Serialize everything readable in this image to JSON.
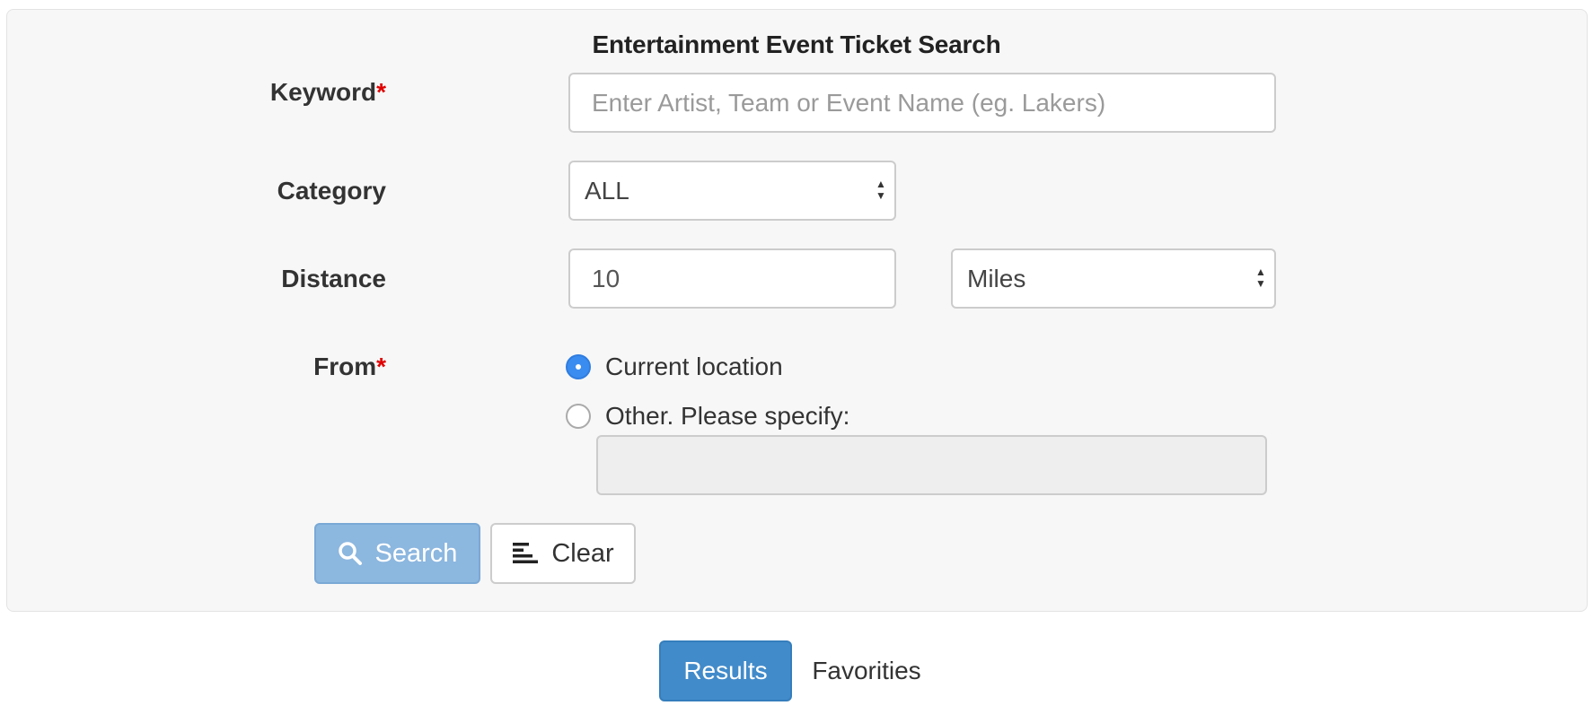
{
  "form": {
    "title": "Entertainment Event Ticket Search",
    "keyword": {
      "label": "Keyword",
      "required_mark": "*",
      "placeholder": "Enter Artist, Team or Event Name (eg. Lakers)"
    },
    "category": {
      "label": "Category",
      "selected": "ALL"
    },
    "distance": {
      "label": "Distance",
      "value": "10",
      "unit_selected": "Miles"
    },
    "from": {
      "label": "From",
      "required_mark": "*",
      "options": [
        {
          "label": "Current location",
          "checked": true
        },
        {
          "label": "Other. Please specify:",
          "checked": false
        }
      ],
      "other_value": ""
    },
    "buttons": {
      "search_label": "Search",
      "search_icon": "search-icon",
      "clear_label": "Clear",
      "clear_icon": "align-left-icon"
    }
  },
  "tabs": {
    "results_label": "Results",
    "favorites_label": "Favorities"
  },
  "colors": {
    "primary": "#428bca",
    "primary_disabled": "#8cb7df",
    "required": "#e00000",
    "radio_checked": "#3b8cf0",
    "panel_bg": "#f7f7f7"
  }
}
